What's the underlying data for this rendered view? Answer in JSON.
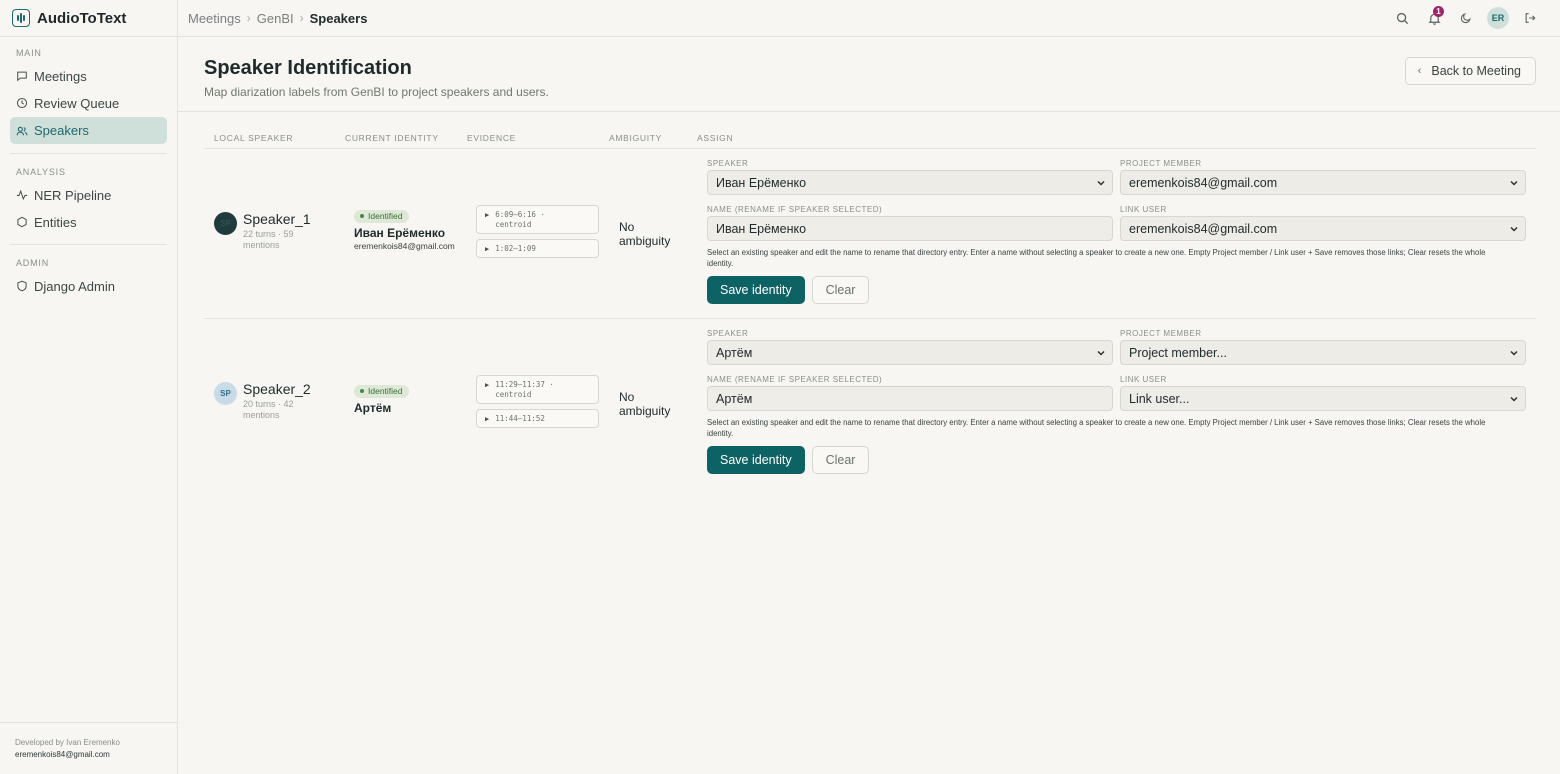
{
  "app": {
    "name": "AudioToText",
    "notification_count": "1",
    "user_initials": "ER"
  },
  "breadcrumb": [
    "Meetings",
    "GenBI",
    "Speakers"
  ],
  "sidebar": {
    "sections": [
      {
        "title": "MAIN",
        "items": [
          {
            "label": "Meetings",
            "icon": "chat-icon"
          },
          {
            "label": "Review Queue",
            "icon": "clock-icon"
          },
          {
            "label": "Speakers",
            "icon": "users-icon",
            "active": true
          }
        ]
      },
      {
        "title": "ANALYSIS",
        "items": [
          {
            "label": "NER Pipeline",
            "icon": "activity-icon"
          },
          {
            "label": "Entities",
            "icon": "hexagon-icon"
          }
        ]
      },
      {
        "title": "ADMIN",
        "items": [
          {
            "label": "Django Admin",
            "icon": "shield-icon"
          }
        ]
      }
    ],
    "footer": {
      "line1": "Developed by Ivan Eremenko",
      "email": "eremenkois84@gmail.com"
    }
  },
  "page": {
    "title": "Speaker Identification",
    "subtitle": "Map diarization labels from GenBI to project speakers and users.",
    "back_label": "Back to Meeting"
  },
  "table": {
    "headers": [
      "LOCAL SPEAKER",
      "CURRENT IDENTITY",
      "EVIDENCE",
      "AMBIGUITY",
      "ASSIGN"
    ],
    "field_labels": {
      "speaker": "SPEAKER",
      "project_member": "PROJECT MEMBER",
      "name": "NAME (RENAME IF SPEAKER SELECTED)",
      "link_user": "LINK USER"
    },
    "help_text": "Select an existing speaker and edit the name to rename that directory entry. Enter a name without selecting a speaker to create a new one. Empty Project member / Link user + Save removes those links; Clear resets the whole identity.",
    "save_label": "Save identity",
    "clear_label": "Clear",
    "rows": [
      {
        "avatar": "SP",
        "label": "Speaker_1",
        "meta": "22 turns · 59 mentions",
        "status": "Identified",
        "identity_name": "Иван Ерёменко",
        "identity_email": "eremenkois84@gmail.com",
        "evidence": [
          {
            "range": "6:09–6:16 ·",
            "tag": "centroid"
          },
          {
            "range": "1:02–1:09",
            "tag": ""
          }
        ],
        "ambiguity": "No ambiguity",
        "speaker": "Иван Ерёменко",
        "project_member": "eremenkois84@gmail.com",
        "name": "Иван Ерёменко",
        "link_user": "eremenkois84@gmail.com"
      },
      {
        "avatar": "SP",
        "label": "Speaker_2",
        "meta": "20 turns · 42 mentions",
        "status": "Identified",
        "identity_name": "Артём",
        "identity_email": "",
        "evidence": [
          {
            "range": "11:29–11:37 ·",
            "tag": "centroid"
          },
          {
            "range": "11:44–11:52",
            "tag": ""
          }
        ],
        "ambiguity": "No ambiguity",
        "speaker": "Артём",
        "project_member": "Project member...",
        "name": "Артём",
        "link_user": "Link user..."
      }
    ]
  }
}
